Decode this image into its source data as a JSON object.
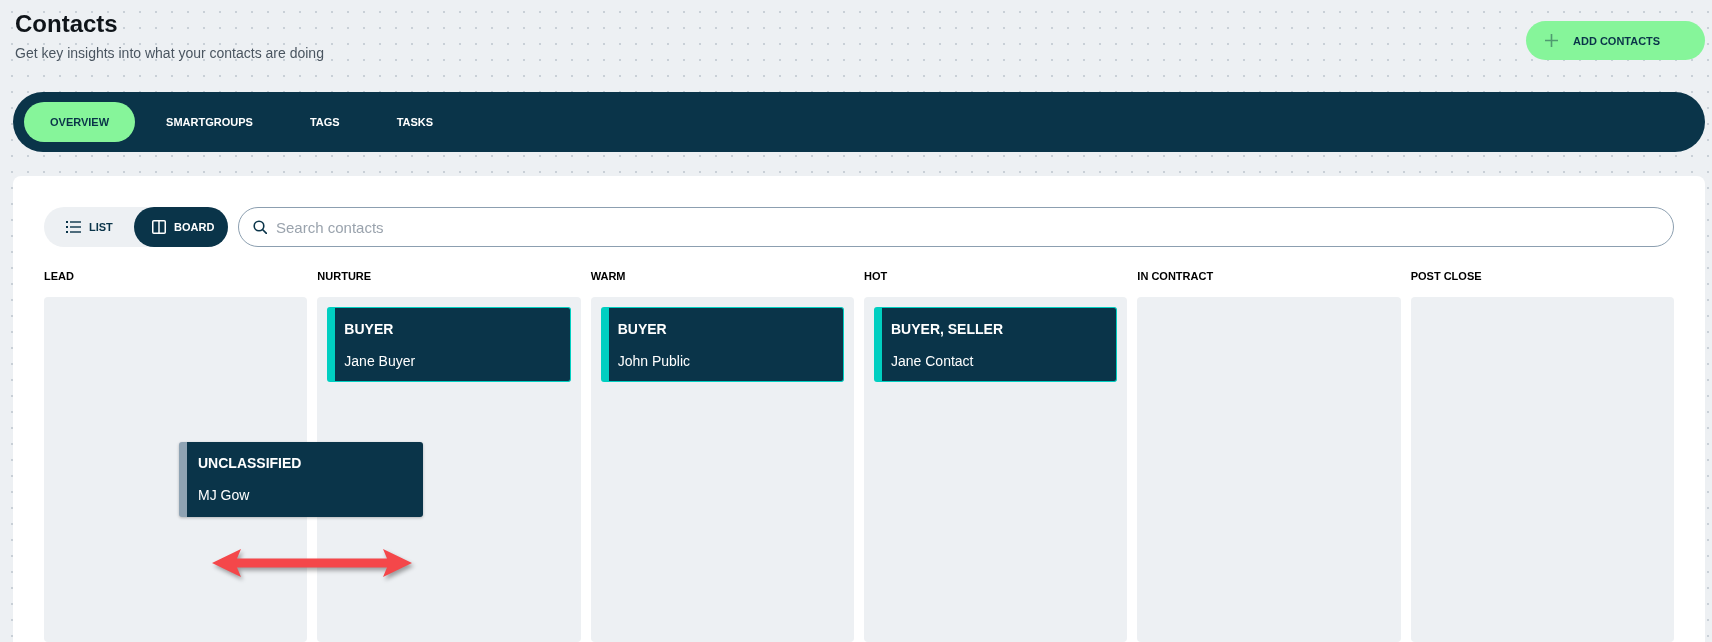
{
  "header": {
    "title": "Contacts",
    "subtitle": "Get key insights into what your contacts are doing",
    "add_button": "ADD CONTACTS"
  },
  "tabs": [
    {
      "label": "OVERVIEW",
      "selected": true
    },
    {
      "label": "SMARTGROUPS",
      "selected": false
    },
    {
      "label": "TAGS",
      "selected": false
    },
    {
      "label": "TASKS",
      "selected": false
    }
  ],
  "view_toggle": [
    {
      "label": "LIST",
      "kind": "list",
      "selected": false
    },
    {
      "label": "BOARD",
      "kind": "board",
      "selected": true
    }
  ],
  "search": {
    "placeholder": "Search contacts"
  },
  "columns": [
    {
      "title": "LEAD"
    },
    {
      "title": "NURTURE",
      "cards": [
        {
          "tag": "BUYER",
          "name": "Jane Buyer",
          "color": "#00cfc1"
        }
      ]
    },
    {
      "title": "WARM",
      "cards": [
        {
          "tag": "BUYER",
          "name": "John Public",
          "color": "#00cfc1"
        }
      ]
    },
    {
      "title": "HOT",
      "cards": [
        {
          "tag": "BUYER, SELLER",
          "name": "Jane Contact",
          "color": "#00cfc1"
        }
      ]
    },
    {
      "title": "IN CONTRACT"
    },
    {
      "title": "POST CLOSE"
    }
  ],
  "dragged_card": {
    "tag": "UNCLASSIFIED",
    "name": "MJ Gow",
    "color": "#8fa3b3"
  }
}
